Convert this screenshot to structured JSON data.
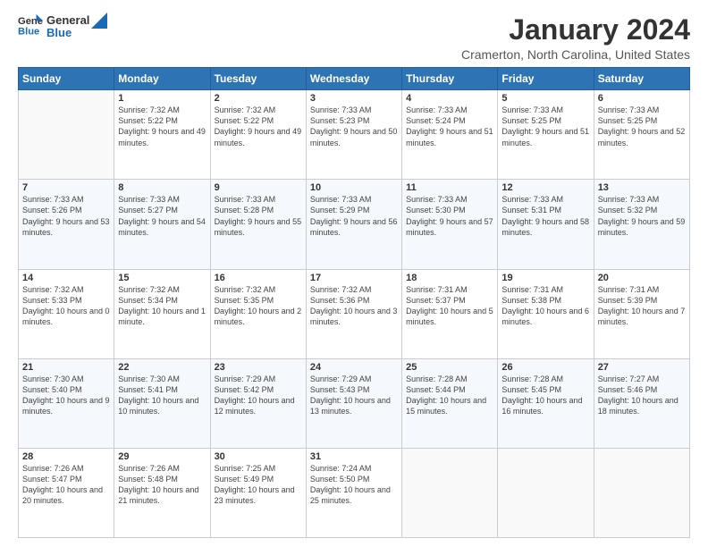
{
  "logo": {
    "text_general": "General",
    "text_blue": "Blue"
  },
  "header": {
    "title": "January 2024",
    "subtitle": "Cramerton, North Carolina, United States"
  },
  "weekdays": [
    "Sunday",
    "Monday",
    "Tuesday",
    "Wednesday",
    "Thursday",
    "Friday",
    "Saturday"
  ],
  "weeks": [
    [
      {
        "day": "",
        "sunrise": "",
        "sunset": "",
        "daylight": ""
      },
      {
        "day": "1",
        "sunrise": "Sunrise: 7:32 AM",
        "sunset": "Sunset: 5:22 PM",
        "daylight": "Daylight: 9 hours and 49 minutes."
      },
      {
        "day": "2",
        "sunrise": "Sunrise: 7:32 AM",
        "sunset": "Sunset: 5:22 PM",
        "daylight": "Daylight: 9 hours and 49 minutes."
      },
      {
        "day": "3",
        "sunrise": "Sunrise: 7:33 AM",
        "sunset": "Sunset: 5:23 PM",
        "daylight": "Daylight: 9 hours and 50 minutes."
      },
      {
        "day": "4",
        "sunrise": "Sunrise: 7:33 AM",
        "sunset": "Sunset: 5:24 PM",
        "daylight": "Daylight: 9 hours and 51 minutes."
      },
      {
        "day": "5",
        "sunrise": "Sunrise: 7:33 AM",
        "sunset": "Sunset: 5:25 PM",
        "daylight": "Daylight: 9 hours and 51 minutes."
      },
      {
        "day": "6",
        "sunrise": "Sunrise: 7:33 AM",
        "sunset": "Sunset: 5:25 PM",
        "daylight": "Daylight: 9 hours and 52 minutes."
      }
    ],
    [
      {
        "day": "7",
        "sunrise": "Sunrise: 7:33 AM",
        "sunset": "Sunset: 5:26 PM",
        "daylight": "Daylight: 9 hours and 53 minutes."
      },
      {
        "day": "8",
        "sunrise": "Sunrise: 7:33 AM",
        "sunset": "Sunset: 5:27 PM",
        "daylight": "Daylight: 9 hours and 54 minutes."
      },
      {
        "day": "9",
        "sunrise": "Sunrise: 7:33 AM",
        "sunset": "Sunset: 5:28 PM",
        "daylight": "Daylight: 9 hours and 55 minutes."
      },
      {
        "day": "10",
        "sunrise": "Sunrise: 7:33 AM",
        "sunset": "Sunset: 5:29 PM",
        "daylight": "Daylight: 9 hours and 56 minutes."
      },
      {
        "day": "11",
        "sunrise": "Sunrise: 7:33 AM",
        "sunset": "Sunset: 5:30 PM",
        "daylight": "Daylight: 9 hours and 57 minutes."
      },
      {
        "day": "12",
        "sunrise": "Sunrise: 7:33 AM",
        "sunset": "Sunset: 5:31 PM",
        "daylight": "Daylight: 9 hours and 58 minutes."
      },
      {
        "day": "13",
        "sunrise": "Sunrise: 7:33 AM",
        "sunset": "Sunset: 5:32 PM",
        "daylight": "Daylight: 9 hours and 59 minutes."
      }
    ],
    [
      {
        "day": "14",
        "sunrise": "Sunrise: 7:32 AM",
        "sunset": "Sunset: 5:33 PM",
        "daylight": "Daylight: 10 hours and 0 minutes."
      },
      {
        "day": "15",
        "sunrise": "Sunrise: 7:32 AM",
        "sunset": "Sunset: 5:34 PM",
        "daylight": "Daylight: 10 hours and 1 minute."
      },
      {
        "day": "16",
        "sunrise": "Sunrise: 7:32 AM",
        "sunset": "Sunset: 5:35 PM",
        "daylight": "Daylight: 10 hours and 2 minutes."
      },
      {
        "day": "17",
        "sunrise": "Sunrise: 7:32 AM",
        "sunset": "Sunset: 5:36 PM",
        "daylight": "Daylight: 10 hours and 3 minutes."
      },
      {
        "day": "18",
        "sunrise": "Sunrise: 7:31 AM",
        "sunset": "Sunset: 5:37 PM",
        "daylight": "Daylight: 10 hours and 5 minutes."
      },
      {
        "day": "19",
        "sunrise": "Sunrise: 7:31 AM",
        "sunset": "Sunset: 5:38 PM",
        "daylight": "Daylight: 10 hours and 6 minutes."
      },
      {
        "day": "20",
        "sunrise": "Sunrise: 7:31 AM",
        "sunset": "Sunset: 5:39 PM",
        "daylight": "Daylight: 10 hours and 7 minutes."
      }
    ],
    [
      {
        "day": "21",
        "sunrise": "Sunrise: 7:30 AM",
        "sunset": "Sunset: 5:40 PM",
        "daylight": "Daylight: 10 hours and 9 minutes."
      },
      {
        "day": "22",
        "sunrise": "Sunrise: 7:30 AM",
        "sunset": "Sunset: 5:41 PM",
        "daylight": "Daylight: 10 hours and 10 minutes."
      },
      {
        "day": "23",
        "sunrise": "Sunrise: 7:29 AM",
        "sunset": "Sunset: 5:42 PM",
        "daylight": "Daylight: 10 hours and 12 minutes."
      },
      {
        "day": "24",
        "sunrise": "Sunrise: 7:29 AM",
        "sunset": "Sunset: 5:43 PM",
        "daylight": "Daylight: 10 hours and 13 minutes."
      },
      {
        "day": "25",
        "sunrise": "Sunrise: 7:28 AM",
        "sunset": "Sunset: 5:44 PM",
        "daylight": "Daylight: 10 hours and 15 minutes."
      },
      {
        "day": "26",
        "sunrise": "Sunrise: 7:28 AM",
        "sunset": "Sunset: 5:45 PM",
        "daylight": "Daylight: 10 hours and 16 minutes."
      },
      {
        "day": "27",
        "sunrise": "Sunrise: 7:27 AM",
        "sunset": "Sunset: 5:46 PM",
        "daylight": "Daylight: 10 hours and 18 minutes."
      }
    ],
    [
      {
        "day": "28",
        "sunrise": "Sunrise: 7:26 AM",
        "sunset": "Sunset: 5:47 PM",
        "daylight": "Daylight: 10 hours and 20 minutes."
      },
      {
        "day": "29",
        "sunrise": "Sunrise: 7:26 AM",
        "sunset": "Sunset: 5:48 PM",
        "daylight": "Daylight: 10 hours and 21 minutes."
      },
      {
        "day": "30",
        "sunrise": "Sunrise: 7:25 AM",
        "sunset": "Sunset: 5:49 PM",
        "daylight": "Daylight: 10 hours and 23 minutes."
      },
      {
        "day": "31",
        "sunrise": "Sunrise: 7:24 AM",
        "sunset": "Sunset: 5:50 PM",
        "daylight": "Daylight: 10 hours and 25 minutes."
      },
      {
        "day": "",
        "sunrise": "",
        "sunset": "",
        "daylight": ""
      },
      {
        "day": "",
        "sunrise": "",
        "sunset": "",
        "daylight": ""
      },
      {
        "day": "",
        "sunrise": "",
        "sunset": "",
        "daylight": ""
      }
    ]
  ]
}
